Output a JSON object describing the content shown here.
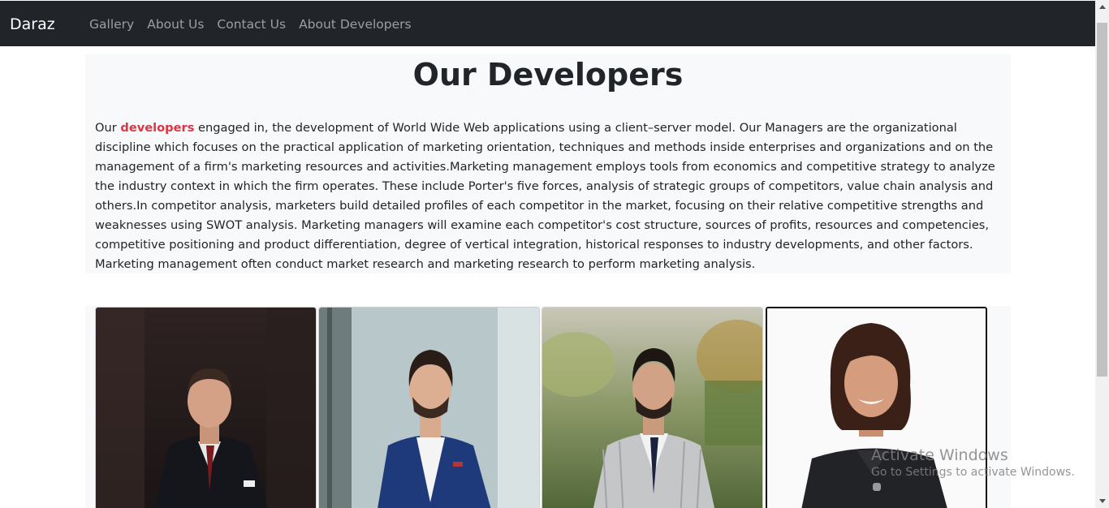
{
  "navbar": {
    "brand": "Daraz",
    "links": [
      "Gallery",
      "About Us",
      "Contact Us",
      "About Developers"
    ]
  },
  "main": {
    "title": "Our Developers",
    "description_prefix": "Our ",
    "description_highlight": "developers",
    "description_body": " engaged in, the development of World Wide Web applications using a client–server model. Our Managers are the organizational discipline which focuses on the practical application of marketing orientation, techniques and methods inside enterprises and organizations and on the management of a firm's marketing resources and activities.Marketing management employs tools from economics and competitive strategy to analyze the industry context in which the firm operates. These include Porter's five forces, analysis of strategic groups of competitors, value chain analysis and others.In competitor analysis, marketers build detailed profiles of each competitor in the market, focusing on their relative competitive strengths and weaknesses using SWOT analysis. Marketing managers will examine each competitor's cost structure, sources of profits, resources and competencies, competitive positioning and product differentiation, degree of vertical integration, historical responses to industry developments, and other factors. Marketing management often conduct market research and marketing research to perform marketing analysis."
  },
  "gallery": {
    "photos": [
      "developer-photo-1",
      "developer-photo-2",
      "developer-photo-3",
      "developer-photo-4"
    ]
  },
  "watermark": {
    "title": "Activate Windows",
    "subtitle": "Go to Settings to activate Windows."
  },
  "colors": {
    "navbar_bg": "#212529",
    "highlight": "#dc3545",
    "panel_bg": "#f8f9fa"
  }
}
